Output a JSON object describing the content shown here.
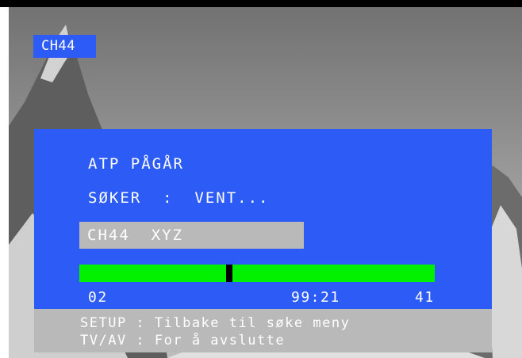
{
  "channel_badge": "CH44",
  "dialog": {
    "title": "ATP PÅGÅR",
    "status": "SØKER  :  VENT...",
    "channel_entry": "CH44  XYZ",
    "progress": {
      "fraction": 0.42,
      "left_value": "02",
      "mid_value": "99:21",
      "right_value": "41"
    }
  },
  "help": {
    "line1": "SETUP : Tilbake til søke meny",
    "line2": "TV/AV : For å avslutte"
  },
  "colors": {
    "panel_blue": "#2c5cf5",
    "progress_green": "#00f000",
    "help_grey": "#b9b9b9",
    "text_white": "#ffffff"
  }
}
